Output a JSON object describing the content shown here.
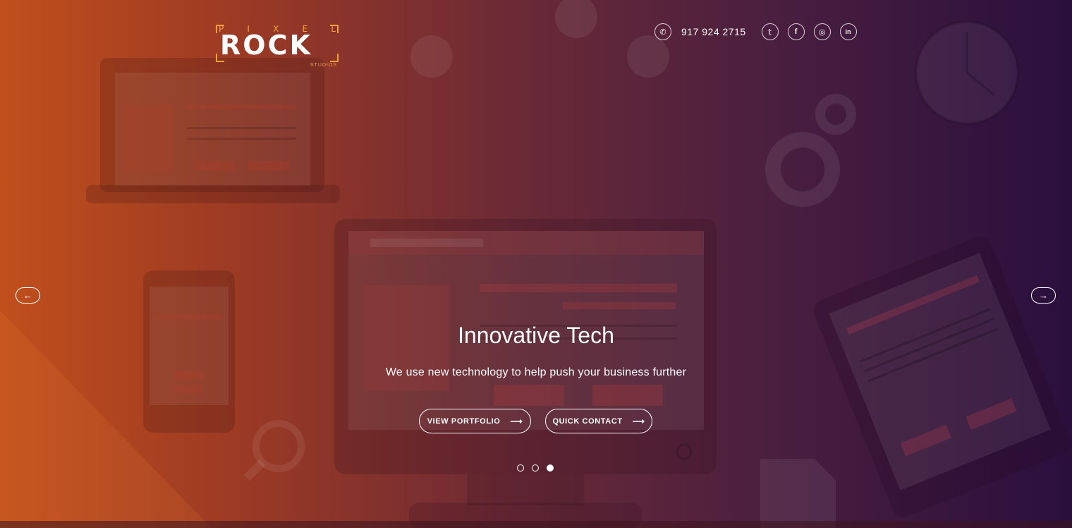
{
  "brand": {
    "logo_top": "PIXEL",
    "logo_main": "ROCK",
    "logo_sub": "STUDIOS"
  },
  "contact": {
    "phone_icon": "phone-icon",
    "phone": "917 924 2715"
  },
  "social": [
    {
      "name": "twitter-icon",
      "glyph": "𝕥"
    },
    {
      "name": "facebook-icon",
      "glyph": "f"
    },
    {
      "name": "instagram-icon",
      "glyph": "◎"
    },
    {
      "name": "linkedin-icon",
      "glyph": "in"
    }
  ],
  "slider": {
    "prev_glyph": "←",
    "next_glyph": "→",
    "title": "Innovative Tech",
    "subtitle": "We use new technology to help push your business further",
    "buttons": {
      "portfolio": "VIEW PORTFOLIO",
      "contact": "QUICK CONTACT",
      "arrow": "⟶"
    },
    "slide_count": 3,
    "active_slide": 3
  },
  "colors": {
    "accent": "#f2a03c",
    "bg_start": "#c14f1c",
    "bg_end": "#2a0f3d",
    "text": "#ffffff"
  }
}
